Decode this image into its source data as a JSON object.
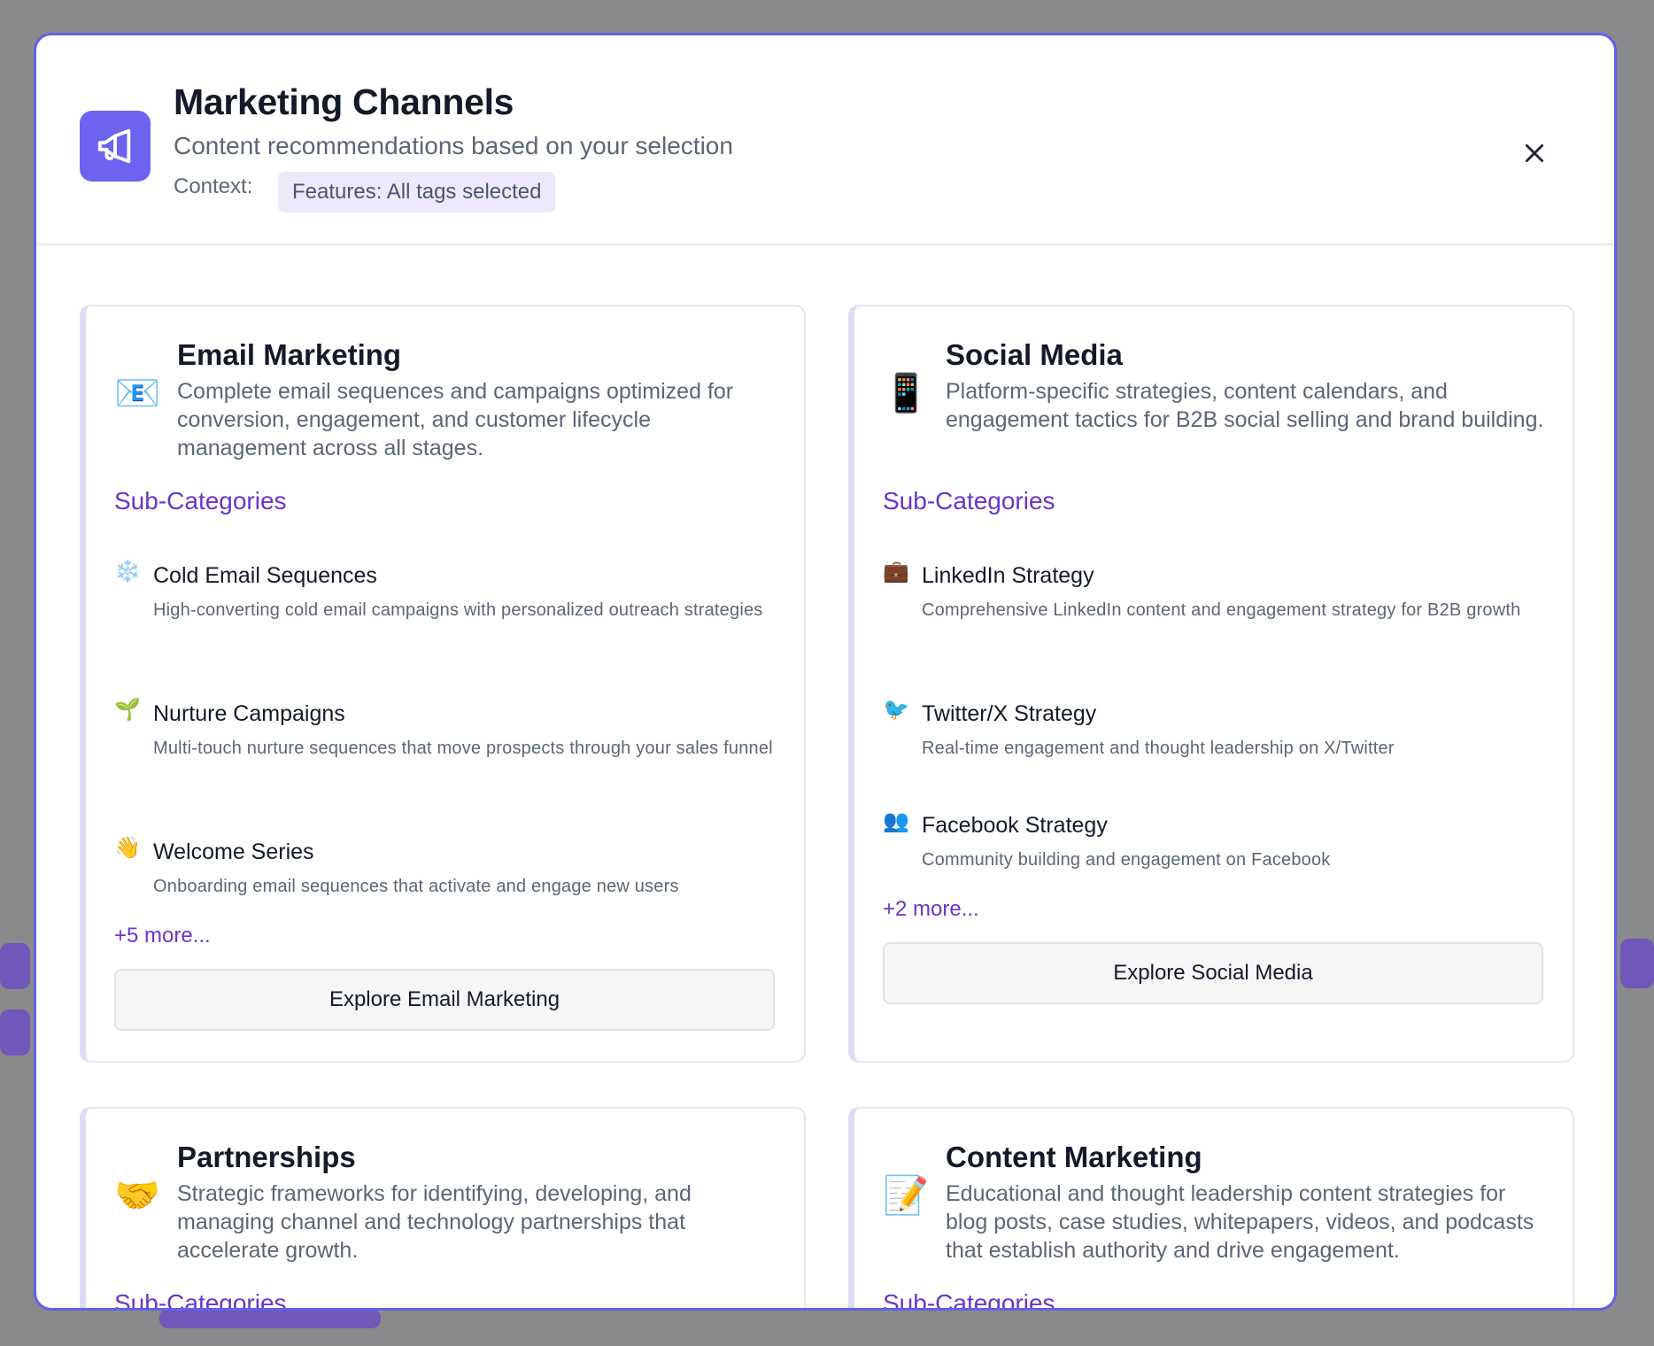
{
  "modal": {
    "title": "Marketing Channels",
    "subtitle": "Content recommendations based on your selection",
    "context_label": "Context:",
    "context_badge": "Features: All tags selected",
    "header_icon": "megaphone-icon",
    "close_icon": "close-icon"
  },
  "cards": [
    {
      "emoji": "📧",
      "title": "Email Marketing",
      "description": "Complete email sequences and campaigns optimized for conversion, engagement, and customer lifecycle management across all stages.",
      "subcategories_heading": "Sub-Categories",
      "subcategories": [
        {
          "emoji": "❄️",
          "title": "Cold Email Sequences",
          "description": "High-converting cold email campaigns with personalized outreach strategies"
        },
        {
          "emoji": "🌱",
          "title": "Nurture Campaigns",
          "description": "Multi-touch nurture sequences that move prospects through your sales funnel"
        },
        {
          "emoji": "👋",
          "title": "Welcome Series",
          "description": "Onboarding email sequences that activate and engage new users"
        }
      ],
      "more": "+5 more...",
      "button": "Explore Email Marketing"
    },
    {
      "emoji": "📱",
      "title": "Social Media",
      "description": "Platform-specific strategies, content calendars, and engagement tactics for B2B social selling and brand building.",
      "subcategories_heading": "Sub-Categories",
      "subcategories": [
        {
          "emoji": "💼",
          "title": "LinkedIn Strategy",
          "description": "Comprehensive LinkedIn content and engagement strategy for B2B growth"
        },
        {
          "emoji": "🐦",
          "title": "Twitter/X Strategy",
          "description": "Real-time engagement and thought leadership on X/Twitter"
        },
        {
          "emoji": "👥",
          "title": "Facebook Strategy",
          "description": "Community building and engagement on Facebook"
        }
      ],
      "more": "+2 more...",
      "button": "Explore Social Media"
    },
    {
      "emoji": "🤝",
      "title": "Partnerships",
      "description": "Strategic frameworks for identifying, developing, and managing channel and technology partnerships that accelerate growth.",
      "subcategories_heading": "Sub-Categories"
    },
    {
      "emoji": "📝",
      "title": "Content Marketing",
      "description": "Educational and thought leadership content strategies for blog posts, case studies, whitepapers, videos, and podcasts that establish authority and drive engagement.",
      "subcategories_heading": "Sub-Categories"
    }
  ]
}
